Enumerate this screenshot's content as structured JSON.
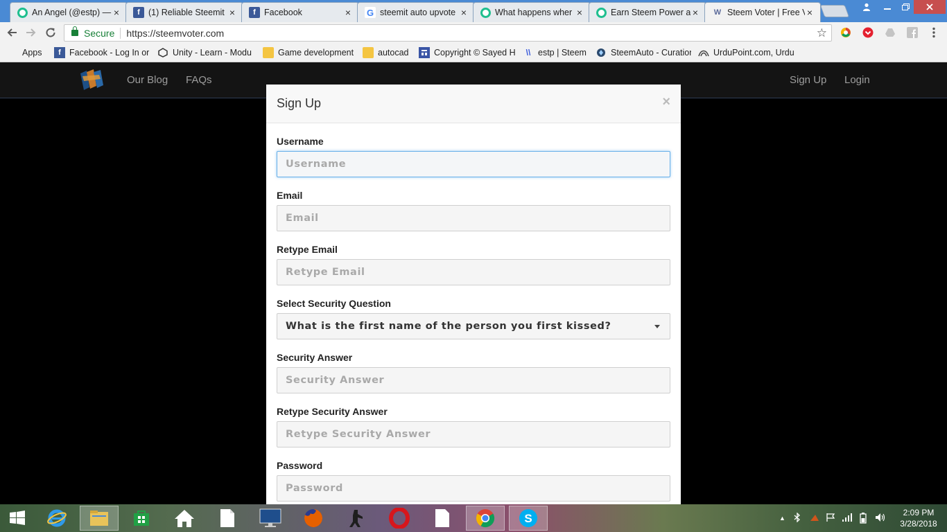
{
  "browser": {
    "tabs": [
      {
        "title": "An Angel (@estp) —",
        "icon": "steemit-icon",
        "active": false
      },
      {
        "title": "(1) Reliable Steemit",
        "icon": "facebook-icon",
        "active": false
      },
      {
        "title": "Facebook",
        "icon": "facebook-icon",
        "active": false
      },
      {
        "title": "steemit auto upvote",
        "icon": "google-icon",
        "active": false
      },
      {
        "title": "What happens wher",
        "icon": "steemit-icon",
        "active": false
      },
      {
        "title": "Earn Steem Power a",
        "icon": "steemit-icon",
        "active": false
      },
      {
        "title": "Steem Voter | Free V",
        "icon": "steemvoter-icon",
        "active": true
      }
    ],
    "address": {
      "secure_label": "Secure",
      "url": "https://steemvoter.com"
    },
    "bookmarks": [
      {
        "label": "Apps",
        "icon": "apps-grid-icon"
      },
      {
        "label": "Facebook - Log In or",
        "icon": "facebook-icon"
      },
      {
        "label": "Unity - Learn - Modu",
        "icon": "unity-icon"
      },
      {
        "label": "Game development",
        "icon": "folder-icon"
      },
      {
        "label": "autocad",
        "icon": "folder-icon"
      },
      {
        "label": "Copyright © Sayed H",
        "icon": "page-icon"
      },
      {
        "label": "estp | Steem",
        "icon": "steem-icon"
      },
      {
        "label": "SteemAuto - Curation",
        "icon": "steemauto-icon"
      },
      {
        "label": "UrduPoint.com, Urdu",
        "icon": "urdupoint-icon"
      }
    ]
  },
  "site": {
    "nav": {
      "blog": "Our Blog",
      "faqs": "FAQs",
      "signup": "Sign Up",
      "login": "Login"
    }
  },
  "modal": {
    "title": "Sign Up",
    "close": "×",
    "fields": {
      "username": {
        "label": "Username",
        "placeholder": "Username"
      },
      "email": {
        "label": "Email",
        "placeholder": "Email"
      },
      "retype_email": {
        "label": "Retype Email",
        "placeholder": "Retype Email"
      },
      "security_question": {
        "label": "Select Security Question",
        "value": "What is the first name of the person you first kissed?"
      },
      "security_answer": {
        "label": "Security Answer",
        "placeholder": "Security Answer"
      },
      "retype_security_answer": {
        "label": "Retype Security Answer",
        "placeholder": "Retype Security Answer"
      },
      "password": {
        "label": "Password",
        "placeholder": "Password"
      }
    }
  },
  "taskbar": {
    "time": "2:09 PM",
    "date": "3/28/2018"
  }
}
